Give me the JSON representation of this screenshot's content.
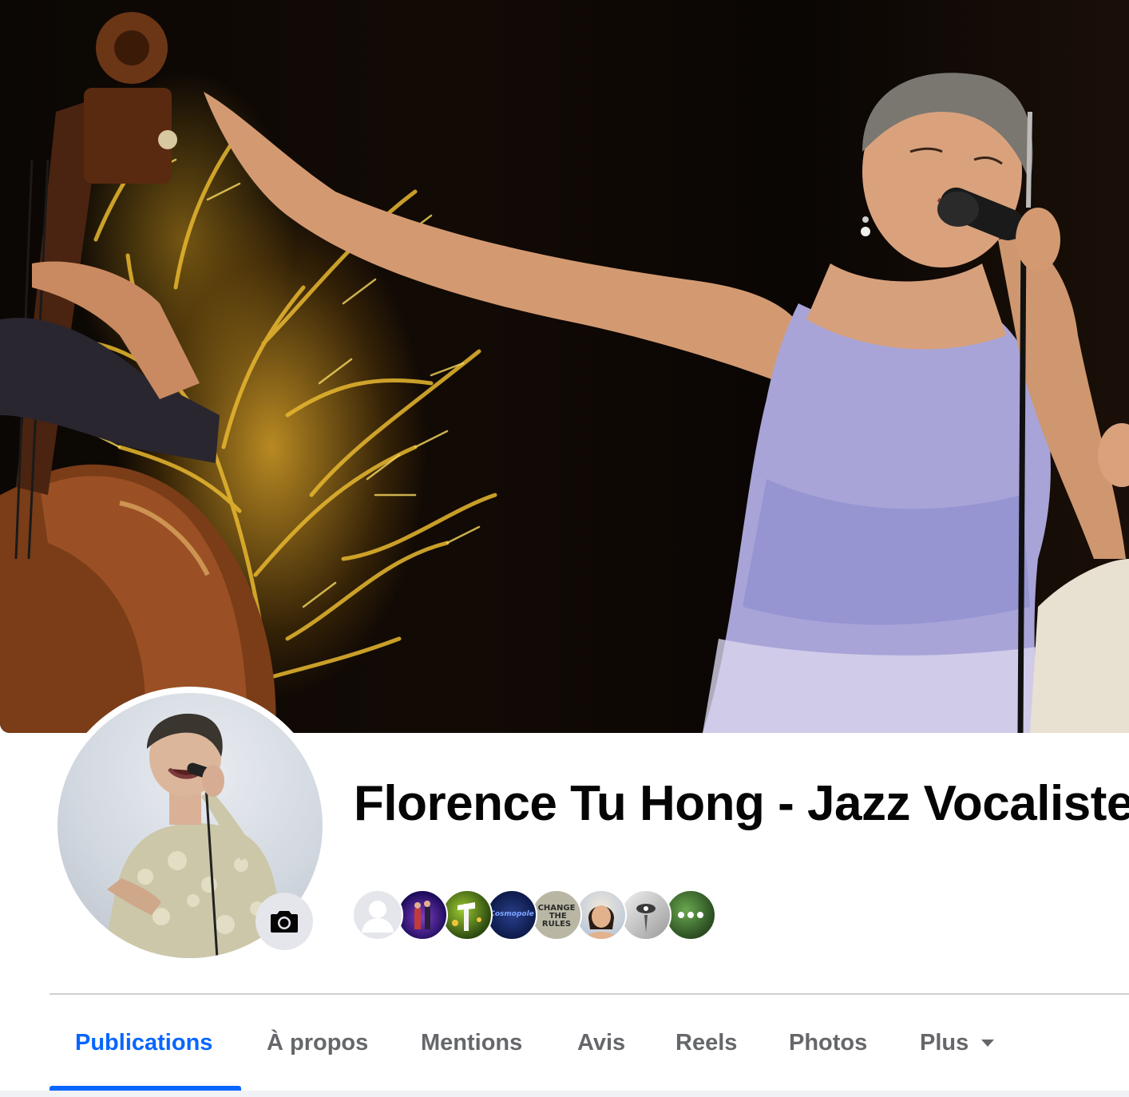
{
  "page": {
    "name": "Florence Tu Hong - Jazz Vocaliste"
  },
  "cover_photo": {
    "description_icon": "cover-photo"
  },
  "profile_photo": {
    "camera_icon": "camera-icon"
  },
  "followers": [
    {
      "icon": "default-user-avatar",
      "text": ""
    },
    {
      "icon": "concert-stage-avatar",
      "text": ""
    },
    {
      "icon": "garden-lights-avatar",
      "text": ""
    },
    {
      "icon": "cosmic-logo-avatar",
      "text": "Cosmopole"
    },
    {
      "icon": "change-the-rules-avatar",
      "text": "CHANGE\n THE\nRULES"
    },
    {
      "icon": "woman-portrait-avatar",
      "text": ""
    },
    {
      "icon": "bw-face-avatar",
      "text": ""
    },
    {
      "icon": "more-avatar",
      "text": ""
    }
  ],
  "tabs": [
    {
      "label": "Publications",
      "active": true
    },
    {
      "label": "À propos",
      "active": false
    },
    {
      "label": "Mentions",
      "active": false
    },
    {
      "label": "Avis",
      "active": false
    },
    {
      "label": "Reels",
      "active": false
    },
    {
      "label": "Photos",
      "active": false
    },
    {
      "label": "Plus",
      "active": false
    }
  ],
  "colors": {
    "accent": "#0866ff",
    "tab_inactive": "#65676b",
    "title": "#050505",
    "divider": "#ced0d4"
  }
}
